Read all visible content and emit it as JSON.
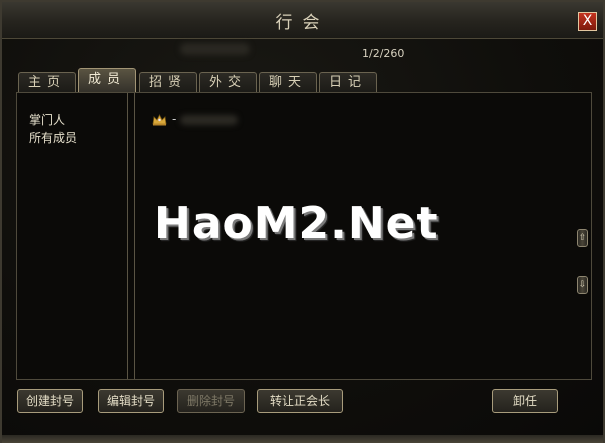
{
  "window": {
    "title": "行会",
    "close_label": "X"
  },
  "header": {
    "page_counter": "1/2/260"
  },
  "tabs": [
    {
      "label": "主页",
      "active": false
    },
    {
      "label": "成员",
      "active": true
    },
    {
      "label": "招贤",
      "active": false
    },
    {
      "label": "外交",
      "active": false
    },
    {
      "label": "聊天",
      "active": false
    },
    {
      "label": "日记",
      "active": false
    }
  ],
  "sidebar": {
    "items": [
      {
        "label": "掌门人"
      },
      {
        "label": "所有成员"
      }
    ]
  },
  "members": [
    {
      "icon": "crown-icon",
      "separator": "-"
    }
  ],
  "watermark": "HaoM2.Net",
  "scrollbar": {
    "up": "⇧",
    "down": "⇩"
  },
  "buttons": {
    "create_title": "创建封号",
    "edit_title": "编辑封号",
    "delete_title": "删除封号",
    "transfer_leader": "转让正会长",
    "resign": "卸任"
  },
  "colors": {
    "accent_close": "#c4331f",
    "text": "#e6e0cc",
    "border": "#a89c7c"
  }
}
